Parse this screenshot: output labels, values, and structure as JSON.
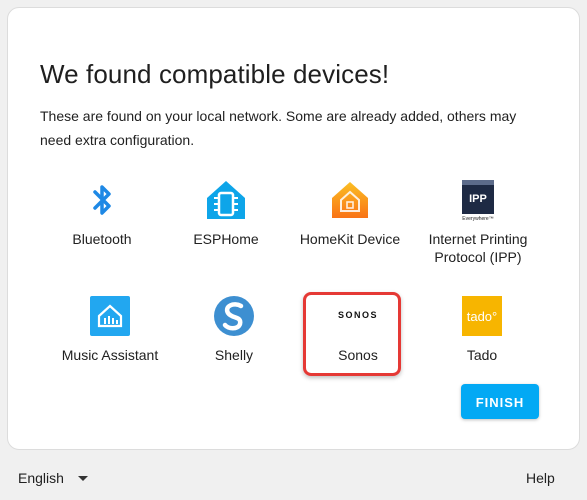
{
  "dialog": {
    "title": "We found compatible devices!",
    "subtitle": "These are found on your local network. Some are already added, others may need extra configuration."
  },
  "devices": [
    {
      "name": "Bluetooth",
      "icon": "bluetooth-icon"
    },
    {
      "name": "ESPHome",
      "icon": "esphome-icon"
    },
    {
      "name": "HomeKit Device",
      "icon": "homekit-icon"
    },
    {
      "name": "Internet Printing Protocol (IPP)",
      "icon": "ipp-icon",
      "icon_text": "IPP",
      "icon_subtext": "Everywhere™"
    },
    {
      "name": "Music Assistant",
      "icon": "music-assistant-icon"
    },
    {
      "name": "Shelly",
      "icon": "shelly-icon"
    },
    {
      "name": "Sonos",
      "icon": "sonos-logo",
      "icon_text": "SONOS"
    },
    {
      "name": "Tado",
      "icon": "tado-icon",
      "icon_text": "tado°"
    }
  ],
  "highlighted_device": "Sonos",
  "finish_label": "FINISH",
  "footer": {
    "language": "English",
    "help": "Help"
  },
  "colors": {
    "accent": "#03a9f4",
    "highlight": "#e53935",
    "bluetooth": "#1e88e5",
    "esphome": "#0ea5e9",
    "homekit": "#f59e0b",
    "music_assistant": "#22a7f0",
    "shelly": "#3d8fd1",
    "tado": "#f7b500"
  }
}
